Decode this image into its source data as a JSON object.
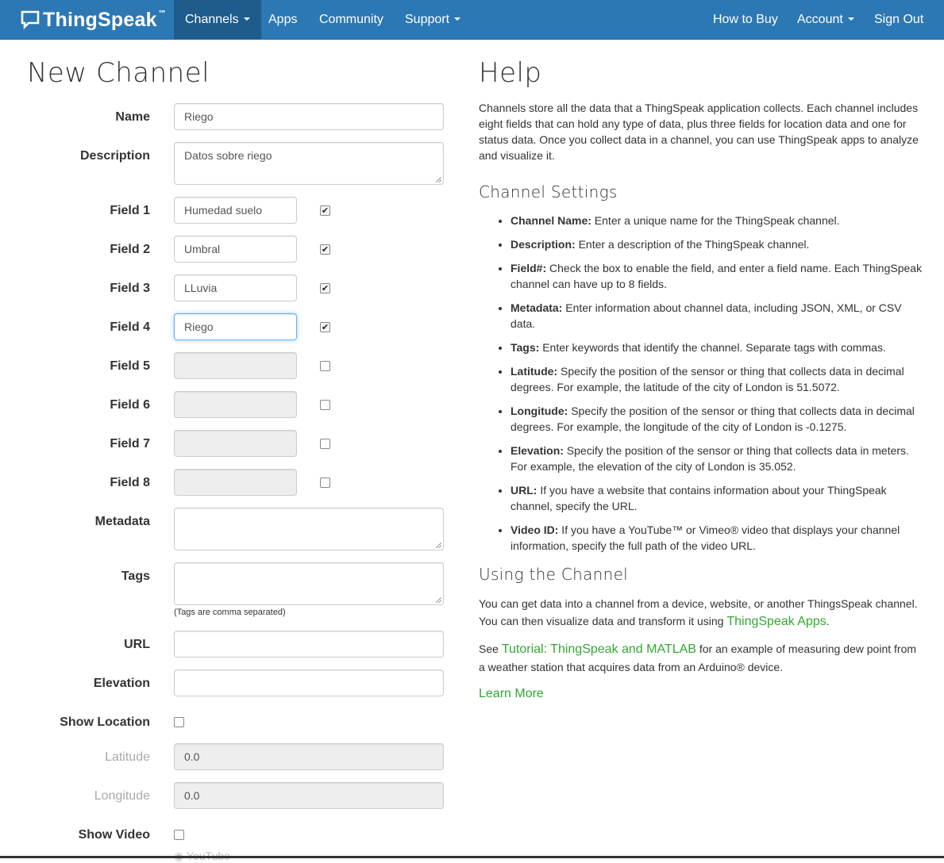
{
  "nav": {
    "brand": "ThingSpeak",
    "brand_tm": "™",
    "left_items": [
      "Channels",
      "Apps",
      "Community",
      "Support"
    ],
    "right_items": [
      "How to Buy",
      "Account",
      "Sign Out"
    ]
  },
  "form": {
    "title": "New Channel",
    "name_label": "Name",
    "name_value": "Riego",
    "description_label": "Description",
    "description_value": "Datos sobre riego",
    "fields": [
      {
        "label": "Field 1",
        "value": "Humedad suelo",
        "checked": true
      },
      {
        "label": "Field 2",
        "value": "Umbral",
        "checked": true
      },
      {
        "label": "Field 3",
        "value": "LLuvia",
        "checked": true
      },
      {
        "label": "Field 4",
        "value": "Riego",
        "checked": true
      },
      {
        "label": "Field 5",
        "value": "",
        "checked": false
      },
      {
        "label": "Field 6",
        "value": "",
        "checked": false
      },
      {
        "label": "Field 7",
        "value": "",
        "checked": false
      },
      {
        "label": "Field 8",
        "value": "",
        "checked": false
      }
    ],
    "metadata_label": "Metadata",
    "tags_label": "Tags",
    "tags_hint": "(Tags are comma separated)",
    "url_label": "URL",
    "elevation_label": "Elevation",
    "show_location_label": "Show Location",
    "latitude_label": "Latitude",
    "latitude_value": "0.0",
    "longitude_label": "Longitude",
    "longitude_value": "0.0",
    "show_video_label": "Show Video",
    "video_option": "YouTube"
  },
  "help": {
    "title": "Help",
    "intro": "Channels store all the data that a ThingSpeak application collects. Each channel includes eight fields that can hold any type of data, plus three fields for location data and one for status data. Once you collect data in a channel, you can use ThingSpeak apps to analyze and visualize it.",
    "settings_title": "Channel Settings",
    "settings": [
      {
        "term": "Channel Name:",
        "text": " Enter a unique name for the ThingSpeak channel."
      },
      {
        "term": "Description:",
        "text": " Enter a description of the ThingSpeak channel."
      },
      {
        "term": "Field#:",
        "text": " Check the box to enable the field, and enter a field name. Each ThingSpeak channel can have up to 8 fields."
      },
      {
        "term": "Metadata:",
        "text": " Enter information about channel data, including JSON, XML, or CSV data."
      },
      {
        "term": "Tags:",
        "text": " Enter keywords that identify the channel. Separate tags with commas."
      },
      {
        "term": "Latitude:",
        "text": " Specify the position of the sensor or thing that collects data in decimal degrees. For example, the latitude of the city of London is 51.5072."
      },
      {
        "term": "Longitude:",
        "text": " Specify the position of the sensor or thing that collects data in decimal degrees. For example, the longitude of the city of London is -0.1275."
      },
      {
        "term": "Elevation:",
        "text": " Specify the position of the sensor or thing that collects data in meters. For example, the elevation of the city of London is 35.052."
      },
      {
        "term": "URL:",
        "text": " If you have a website that contains information about your ThingSpeak channel, specify the URL."
      },
      {
        "term": "Video ID:",
        "text": " If you have a YouTube™ or Vimeo® video that displays your channel information, specify the full path of the video URL."
      }
    ],
    "using_title": "Using the Channel",
    "using_p1_a": "You can get data into a channel from a device, website, or another ThingsSpeak channel. You can then visualize data and transform it using ",
    "using_p1_link": "ThingSpeak Apps",
    "using_p1_b": ".",
    "using_p2_a": "See ",
    "using_p2_link": "Tutorial: ThingSpeak and MATLAB",
    "using_p2_b": " for an example of measuring dew point from a weather station that acquires data from an Arduino® device.",
    "learn_more": "Learn More"
  },
  "colors": {
    "navbar": "#2c78b4",
    "navbar_active": "#1d5c8c",
    "link": "#33a833"
  }
}
